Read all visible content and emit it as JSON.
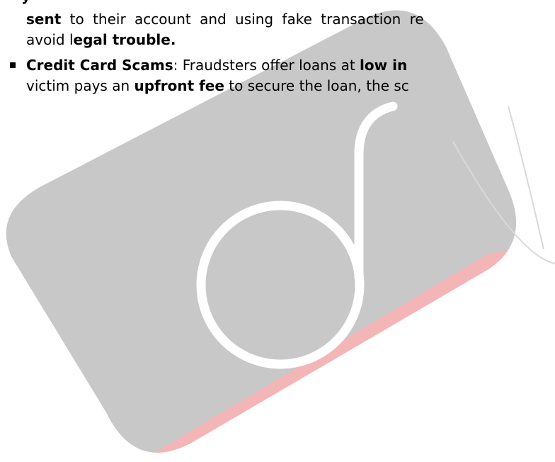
{
  "watermark": {
    "logo_name": "d-logo-watermark",
    "colors": {
      "tile": "#c8c8c8",
      "accent": "#f4b5b6",
      "glyph": "#ffffff",
      "right_outline": "#d9d9d9"
    }
  },
  "document": {
    "cutoff_top_text": "y",
    "para1": {
      "line1_b1": "sent",
      "line1_t1": " to their account and using fake transaction re",
      "line2_t1": "avoid l",
      "line2_b1": "egal trouble."
    },
    "bullet_credit_card": {
      "title": "Credit Card Scams",
      "line1_t1": ": Fraudsters offer loans at ",
      "line1_b1": "low in",
      "line2_t1": "victim pays an ",
      "line2_b1": "upfront fee",
      "line2_t2": " to secure the loan, the sc"
    }
  }
}
